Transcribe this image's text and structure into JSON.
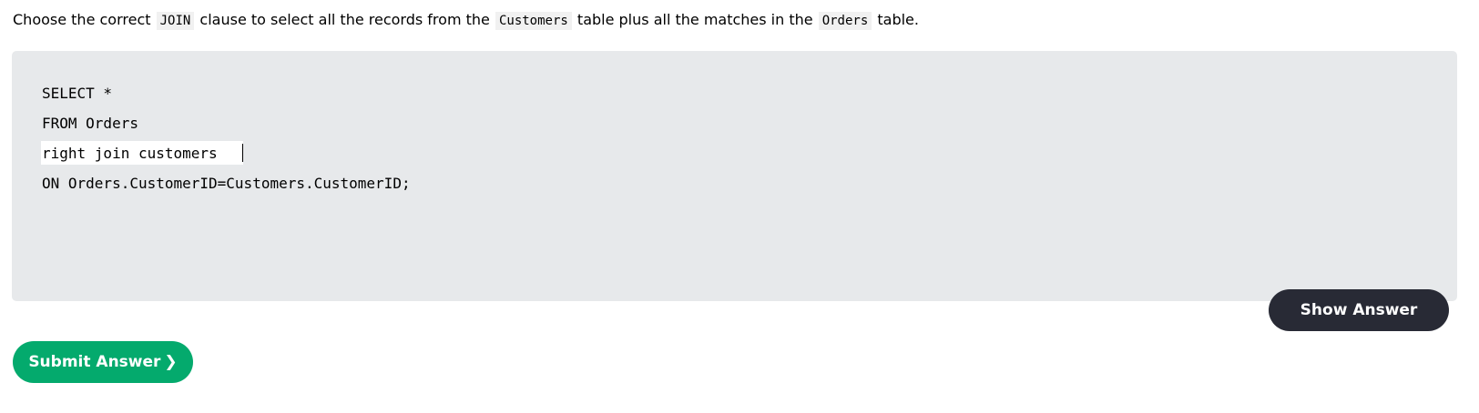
{
  "question": {
    "part1": "Choose the correct ",
    "code1": "JOIN",
    "part2": " clause to select all the records from the ",
    "code2": "Customers",
    "part3": " table plus all the matches in the ",
    "code3": "Orders",
    "part4": " table."
  },
  "code": {
    "line1": "SELECT *",
    "line2": "FROM Orders",
    "answer_value": "right join customers",
    "line4": "ON Orders.CustomerID=Customers.CustomerID;"
  },
  "buttons": {
    "show_answer": "Show Answer",
    "submit_answer": "Submit Answer",
    "submit_chevron": "❯"
  },
  "colors": {
    "panel_bg": "#e7e9eb",
    "show_answer_bg": "#282a35",
    "submit_bg": "#04aa6d"
  }
}
